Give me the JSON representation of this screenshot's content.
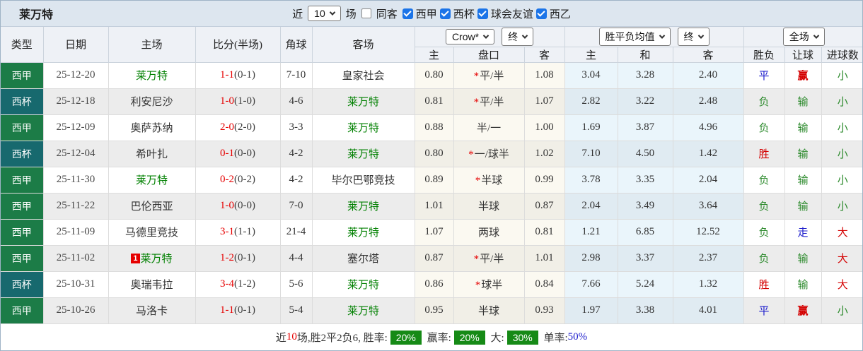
{
  "title": "莱万特",
  "colors": {
    "league_green": "#1c7c47",
    "cup_teal": "#17696e",
    "team_green": "#008000",
    "score_red": "#e60000",
    "win_red": "#d40000",
    "draw_blue": "#1c1ccc",
    "lose_green": "#2c8a2c",
    "badge_green": "#168a16",
    "checkbox_blue": "#1b74e8",
    "crow_bg": "#fbf9f1",
    "crow_bg_alt": "#f1efe7",
    "avg_bg": "#eaf5fb",
    "avg_bg_alt": "#e0ebf2"
  },
  "controls": {
    "near_label": "近",
    "match_count": "10",
    "matches_label": "场",
    "same_venue_label": "同客",
    "league_filters": [
      {
        "label": "西甲",
        "checked": true
      },
      {
        "label": "西杯",
        "checked": true
      },
      {
        "label": "球会友谊",
        "checked": true
      },
      {
        "label": "西乙",
        "checked": true
      }
    ]
  },
  "header": {
    "columns": [
      "类型",
      "日期",
      "主场",
      "比分(半场)",
      "角球",
      "客场"
    ],
    "odds_group": {
      "bookmaker": "Crow*",
      "time": "终"
    },
    "avg_group": {
      "name": "胜平负均值",
      "time": "终"
    },
    "result_group": {
      "scope": "全场"
    },
    "sub": [
      "主",
      "盘口",
      "客",
      "主",
      "和",
      "客",
      "胜负",
      "让球",
      "进球数"
    ]
  },
  "rows": [
    {
      "type": "西甲",
      "type_color": "green",
      "date": "25-12-20",
      "home": "莱万特",
      "home_is_team": true,
      "home_badge": "",
      "score": "1-1",
      "half": "(0-1)",
      "corner": "7-10",
      "away": "皇家社会",
      "away_is_team": false,
      "odds_home": "0.80",
      "handicap_star": true,
      "handicap": "平/半",
      "odds_away": "1.08",
      "avg_home": "3.04",
      "avg_draw": "3.28",
      "avg_away": "2.40",
      "result": "平",
      "result_color": "blue",
      "handicap_result": "赢",
      "handicap_color": "red",
      "handicap_bold": true,
      "goals": "小",
      "goals_color": "green"
    },
    {
      "type": "西杯",
      "type_color": "teal",
      "date": "25-12-18",
      "home": "利安尼沙",
      "home_is_team": false,
      "home_badge": "",
      "score": "1-0",
      "half": "(1-0)",
      "corner": "4-6",
      "away": "莱万特",
      "away_is_team": true,
      "odds_home": "0.81",
      "handicap_star": true,
      "handicap": "平/半",
      "odds_away": "1.07",
      "avg_home": "2.82",
      "avg_draw": "3.22",
      "avg_away": "2.48",
      "result": "负",
      "result_color": "green",
      "handicap_result": "输",
      "handicap_color": "green",
      "handicap_bold": false,
      "goals": "小",
      "goals_color": "green"
    },
    {
      "type": "西甲",
      "type_color": "green",
      "date": "25-12-09",
      "home": "奥萨苏纳",
      "home_is_team": false,
      "home_badge": "",
      "score": "2-0",
      "half": "(2-0)",
      "corner": "3-3",
      "away": "莱万特",
      "away_is_team": true,
      "odds_home": "0.88",
      "handicap_star": false,
      "handicap": "半/一",
      "odds_away": "1.00",
      "avg_home": "1.69",
      "avg_draw": "3.87",
      "avg_away": "4.96",
      "result": "负",
      "result_color": "green",
      "handicap_result": "输",
      "handicap_color": "green",
      "handicap_bold": false,
      "goals": "小",
      "goals_color": "green"
    },
    {
      "type": "西杯",
      "type_color": "teal",
      "date": "25-12-04",
      "home": "希叶扎",
      "home_is_team": false,
      "home_badge": "",
      "score": "0-1",
      "half": "(0-0)",
      "corner": "4-2",
      "away": "莱万特",
      "away_is_team": true,
      "odds_home": "0.80",
      "handicap_star": true,
      "handicap": "一/球半",
      "odds_away": "1.02",
      "avg_home": "7.10",
      "avg_draw": "4.50",
      "avg_away": "1.42",
      "result": "胜",
      "result_color": "red",
      "handicap_result": "输",
      "handicap_color": "green",
      "handicap_bold": false,
      "goals": "小",
      "goals_color": "green"
    },
    {
      "type": "西甲",
      "type_color": "green",
      "date": "25-11-30",
      "home": "莱万特",
      "home_is_team": true,
      "home_badge": "",
      "score": "0-2",
      "half": "(0-2)",
      "corner": "4-2",
      "away": "毕尔巴鄂竞技",
      "away_is_team": false,
      "odds_home": "0.89",
      "handicap_star": true,
      "handicap": "半球",
      "odds_away": "0.99",
      "avg_home": "3.78",
      "avg_draw": "3.35",
      "avg_away": "2.04",
      "result": "负",
      "result_color": "green",
      "handicap_result": "输",
      "handicap_color": "green",
      "handicap_bold": false,
      "goals": "小",
      "goals_color": "green"
    },
    {
      "type": "西甲",
      "type_color": "green",
      "date": "25-11-22",
      "home": "巴伦西亚",
      "home_is_team": false,
      "home_badge": "",
      "score": "1-0",
      "half": "(0-0)",
      "corner": "7-0",
      "away": "莱万特",
      "away_is_team": true,
      "odds_home": "1.01",
      "handicap_star": false,
      "handicap": "半球",
      "odds_away": "0.87",
      "avg_home": "2.04",
      "avg_draw": "3.49",
      "avg_away": "3.64",
      "result": "负",
      "result_color": "green",
      "handicap_result": "输",
      "handicap_color": "green",
      "handicap_bold": false,
      "goals": "小",
      "goals_color": "green"
    },
    {
      "type": "西甲",
      "type_color": "green",
      "date": "25-11-09",
      "home": "马德里竞技",
      "home_is_team": false,
      "home_badge": "",
      "score": "3-1",
      "half": "(1-1)",
      "corner": "21-4",
      "away": "莱万特",
      "away_is_team": true,
      "odds_home": "1.07",
      "handicap_star": false,
      "handicap": "两球",
      "odds_away": "0.81",
      "avg_home": "1.21",
      "avg_draw": "6.85",
      "avg_away": "12.52",
      "result": "负",
      "result_color": "green",
      "handicap_result": "走",
      "handicap_color": "blue",
      "handicap_bold": false,
      "goals": "大",
      "goals_color": "red"
    },
    {
      "type": "西甲",
      "type_color": "green",
      "date": "25-11-02",
      "home": "莱万特",
      "home_is_team": true,
      "home_badge": "1",
      "score": "1-2",
      "half": "(0-1)",
      "corner": "4-4",
      "away": "塞尔塔",
      "away_is_team": false,
      "odds_home": "0.87",
      "handicap_star": true,
      "handicap": "平/半",
      "odds_away": "1.01",
      "avg_home": "2.98",
      "avg_draw": "3.37",
      "avg_away": "2.37",
      "result": "负",
      "result_color": "green",
      "handicap_result": "输",
      "handicap_color": "green",
      "handicap_bold": false,
      "goals": "大",
      "goals_color": "red"
    },
    {
      "type": "西杯",
      "type_color": "teal",
      "date": "25-10-31",
      "home": "奥瑞韦拉",
      "home_is_team": false,
      "home_badge": "",
      "score": "3-4",
      "half": "(1-2)",
      "corner": "5-6",
      "away": "莱万特",
      "away_is_team": true,
      "odds_home": "0.86",
      "handicap_star": true,
      "handicap": "球半",
      "odds_away": "0.84",
      "avg_home": "7.66",
      "avg_draw": "5.24",
      "avg_away": "1.32",
      "result": "胜",
      "result_color": "red",
      "handicap_result": "输",
      "handicap_color": "green",
      "handicap_bold": false,
      "goals": "大",
      "goals_color": "red"
    },
    {
      "type": "西甲",
      "type_color": "green",
      "date": "25-10-26",
      "home": "马洛卡",
      "home_is_team": false,
      "home_badge": "",
      "score": "1-1",
      "half": "(0-1)",
      "corner": "5-4",
      "away": "莱万特",
      "away_is_team": true,
      "odds_home": "0.95",
      "handicap_star": false,
      "handicap": "半球",
      "odds_away": "0.93",
      "avg_home": "1.97",
      "avg_draw": "3.38",
      "avg_away": "4.01",
      "result": "平",
      "result_color": "blue",
      "handicap_result": "赢",
      "handicap_color": "red",
      "handicap_bold": true,
      "goals": "小",
      "goals_color": "green"
    }
  ],
  "footer": {
    "segments": [
      {
        "kind": "text",
        "text": "近",
        "color": "#333333"
      },
      {
        "kind": "text",
        "text": "10",
        "color": "#e60000"
      },
      {
        "kind": "text",
        "text": "场,胜2平2负6, 胜率:",
        "color": "#333333"
      },
      {
        "kind": "badge",
        "text": "20%"
      },
      {
        "kind": "text",
        "text": " 赢率:",
        "color": "#333333"
      },
      {
        "kind": "badge",
        "text": "20%"
      },
      {
        "kind": "text",
        "text": " 大:",
        "color": "#333333"
      },
      {
        "kind": "badge",
        "text": "30%"
      },
      {
        "kind": "text",
        "text": " 单率:",
        "color": "#333333"
      },
      {
        "kind": "text",
        "text": "50%",
        "color": "#1c1ccc"
      }
    ]
  }
}
